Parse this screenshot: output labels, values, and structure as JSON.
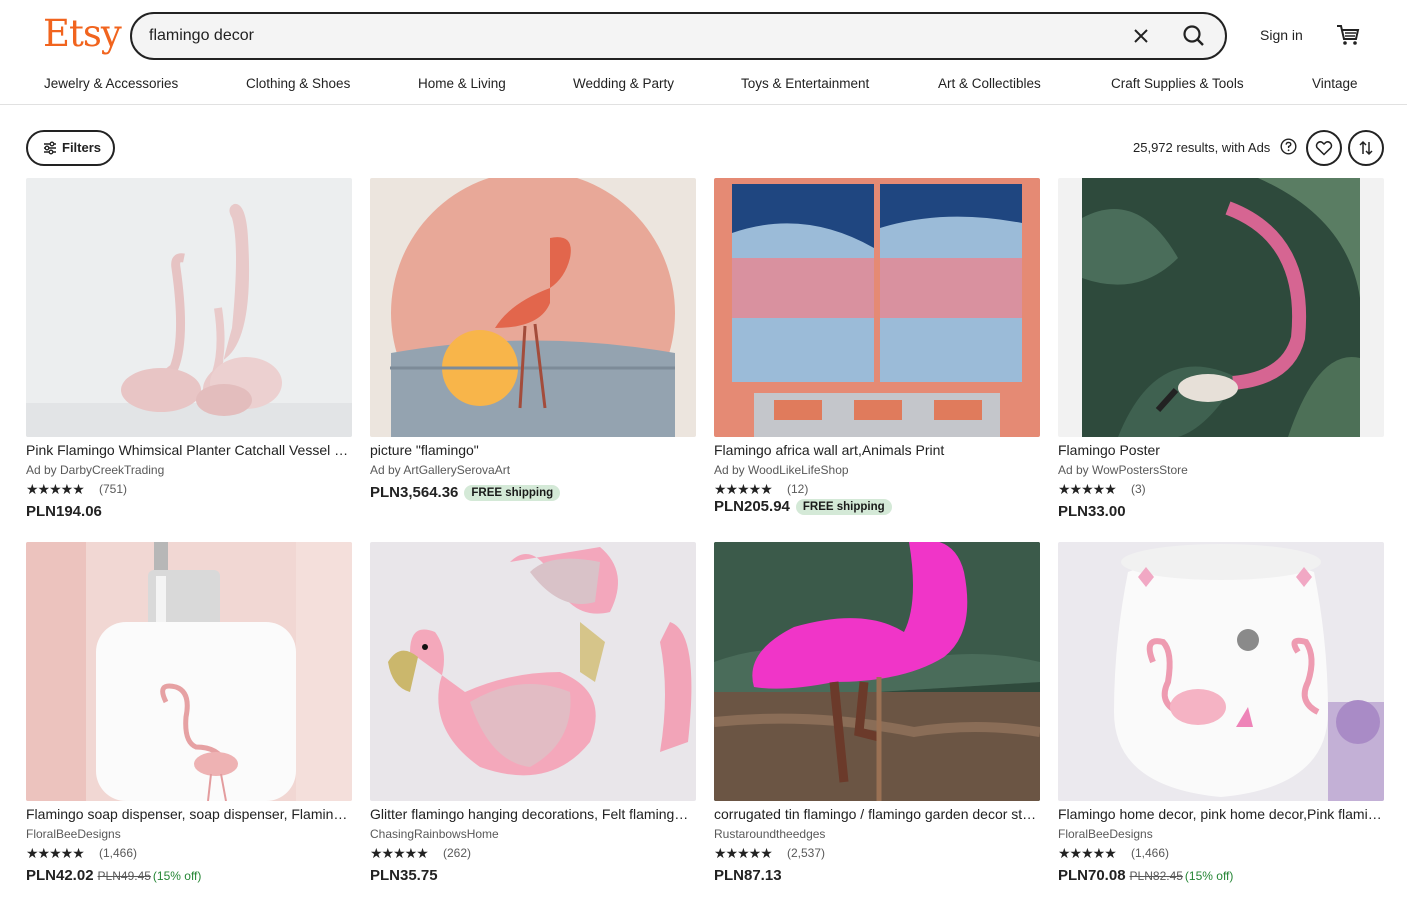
{
  "brand": "Etsy",
  "search": {
    "query": "flamingo decor"
  },
  "header": {
    "sign_in": "Sign in"
  },
  "nav": [
    "Jewelry & Accessories",
    "Clothing & Shoes",
    "Home & Living",
    "Wedding & Party",
    "Toys & Entertainment",
    "Art & Collectibles",
    "Craft Supplies & Tools",
    "Vintage"
  ],
  "toolbar": {
    "filters_label": "Filters",
    "results_text": "25,972 results, with Ads"
  },
  "listings": [
    {
      "title": "Pink Flamingo Whimsical Planter Catchall Vessel Sculpture Bird Decor",
      "shop": "Ad by DarbyCreekTrading",
      "stars": "★★★★★",
      "reviews": "(751)",
      "price": "PLN194.06"
    },
    {
      "title": "picture \"flamingo\"",
      "shop": "Ad by ArtGallerySerovaArt",
      "price": "PLN3,564.36",
      "shipping": "FREE shipping"
    },
    {
      "title": "Flamingo africa wall art,Animals Print",
      "shop": "Ad by WoodLikeLifeShop",
      "stars": "★★★★★",
      "reviews": "(12)",
      "price": "PLN205.94",
      "shipping": "FREE shipping"
    },
    {
      "title": "Flamingo Poster",
      "shop": "Ad by WowPostersStore",
      "stars": "★★★★★",
      "reviews": "(3)",
      "price": "PLN33.00"
    },
    {
      "title": "Flamingo soap dispenser, soap dispenser, Flamingo gift",
      "shop": "FloralBeeDesigns",
      "stars": "★★★★★",
      "reviews": "(1,466)",
      "price": "PLN42.02",
      "original_price": "PLN49.45",
      "discount": "(15% off)"
    },
    {
      "title": "Glitter flamingo hanging decorations, Felt flamingo ornaments",
      "shop": "ChasingRainbowsHome",
      "stars": "★★★★★",
      "reviews": "(262)",
      "price": "PLN35.75"
    },
    {
      "title": "corrugated tin flamingo / flamingo garden decor stake",
      "shop": "Rustaroundtheedges",
      "stars": "★★★★★",
      "reviews": "(2,537)",
      "price": "PLN87.13"
    },
    {
      "title": "Flamingo home decor, pink home decor,Pink flamingo wax burner",
      "shop": "FloralBeeDesigns",
      "stars": "★★★★★",
      "reviews": "(1,466)",
      "price": "PLN70.08",
      "original_price": "PLN82.45",
      "discount": "(15% off)"
    }
  ],
  "colors": {
    "brand": "#f1641e",
    "free_shipping_bg": "#d4e9d7",
    "discount": "#258635"
  }
}
